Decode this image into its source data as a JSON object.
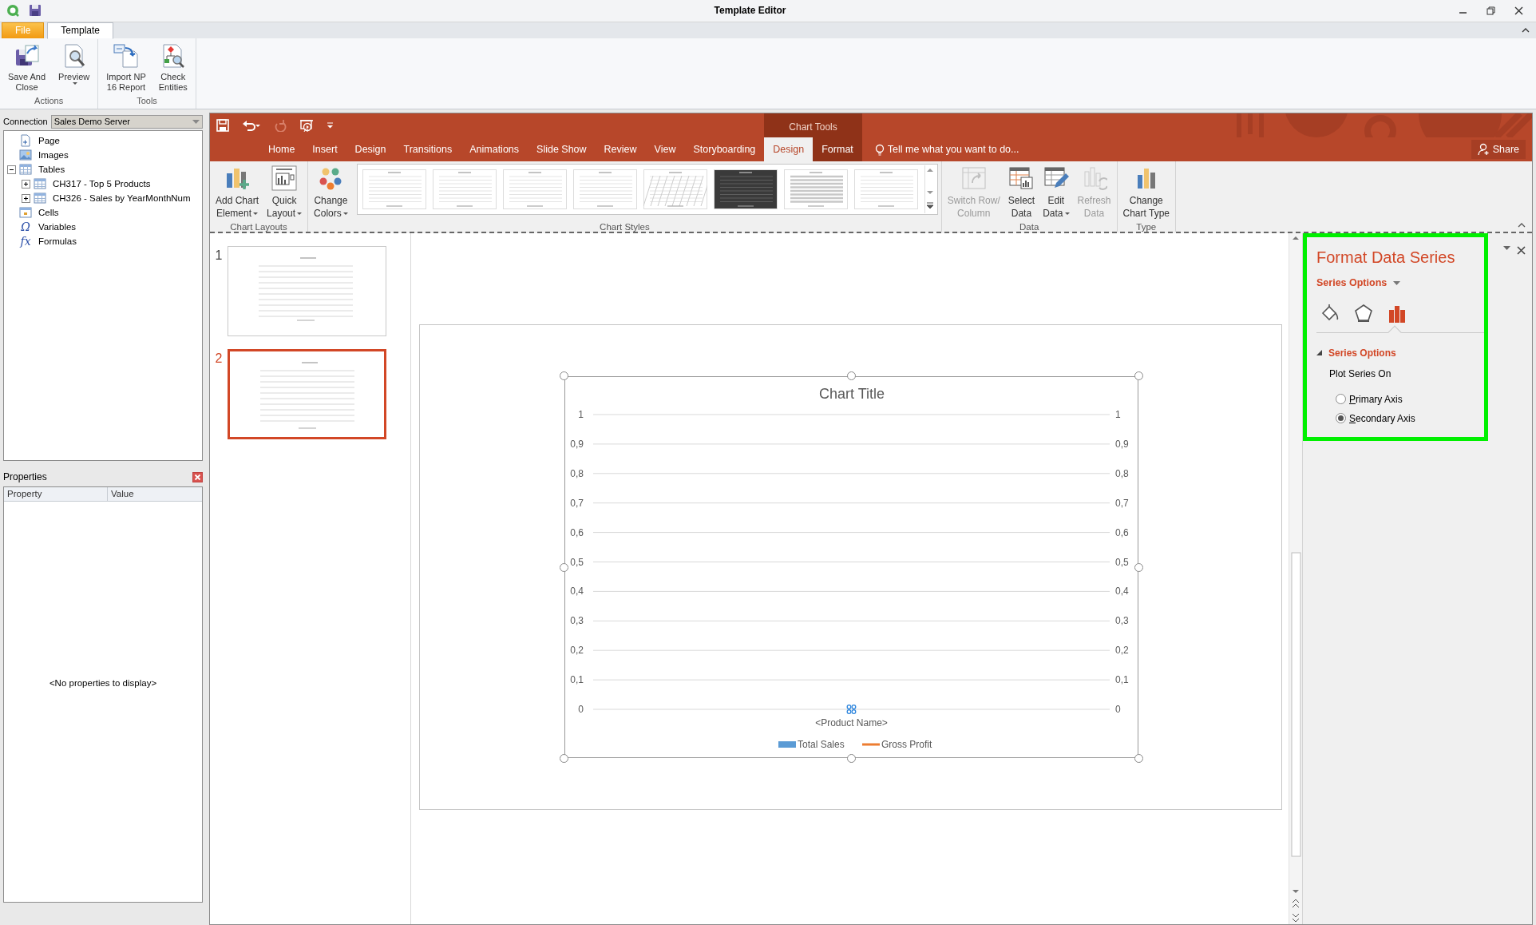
{
  "window": {
    "title": "Template Editor"
  },
  "app_tabs": [
    {
      "label": "File",
      "kind": "file",
      "selected": false
    },
    {
      "label": "Template",
      "kind": "tab",
      "selected": true
    }
  ],
  "app_ribbon": [
    {
      "label": "Actions",
      "buttons": [
        {
          "label": "Save And\nClose",
          "kind": "save",
          "dropdown": false
        },
        {
          "label": "Preview",
          "kind": "preview",
          "dropdown": true
        }
      ]
    },
    {
      "label": "Tools",
      "buttons": [
        {
          "label": "Import NP\n16 Report",
          "kind": "import",
          "dropdown": false
        },
        {
          "label": "Check\nEntities",
          "kind": "check",
          "dropdown": false
        }
      ]
    }
  ],
  "connection": {
    "label": "Connection",
    "value": "Sales Demo Server"
  },
  "tree": [
    {
      "label": "Page",
      "kind": "page"
    },
    {
      "label": "Images",
      "kind": "images"
    },
    {
      "label": "Tables",
      "kind": "table",
      "expanded": true,
      "children": [
        {
          "label": "CH317 - Top 5 Products",
          "kind": "table",
          "expanded": false
        },
        {
          "label": "CH326 - Sales by YearMonthNum",
          "kind": "table",
          "expanded": false
        }
      ]
    },
    {
      "label": "Cells",
      "kind": "cells"
    },
    {
      "label": "Variables",
      "kind": "glyph",
      "glyph": "Ω"
    },
    {
      "label": "Formulas",
      "kind": "glyph",
      "glyph": "fx"
    }
  ],
  "properties": {
    "title": "Properties",
    "columns": [
      "Property",
      "Value"
    ],
    "empty_text": "<No properties to display>"
  },
  "ppt": {
    "contextual_label": "Chart Tools",
    "tabs": [
      {
        "label": "Home",
        "contextual": false,
        "selected": false
      },
      {
        "label": "Insert",
        "contextual": false,
        "selected": false
      },
      {
        "label": "Design",
        "contextual": false,
        "selected": false
      },
      {
        "label": "Transitions",
        "contextual": false,
        "selected": false
      },
      {
        "label": "Animations",
        "contextual": false,
        "selected": false
      },
      {
        "label": "Slide Show",
        "contextual": false,
        "selected": false
      },
      {
        "label": "Review",
        "contextual": false,
        "selected": false
      },
      {
        "label": "View",
        "contextual": false,
        "selected": false
      },
      {
        "label": "Storyboarding",
        "contextual": false,
        "selected": false
      },
      {
        "label": "Design",
        "contextual": true,
        "selected": true
      },
      {
        "label": "Format",
        "contextual": true,
        "selected": false
      }
    ],
    "tell_me": "Tell me what you want to do...",
    "share": "Share",
    "ribbon": [
      {
        "label": "Chart Layouts",
        "buttons": [
          {
            "label": "Add Chart\nElement",
            "kind": "add-element",
            "dropdown": true,
            "disabled": false
          },
          {
            "label": "Quick\nLayout",
            "kind": "quick-layout",
            "dropdown": true,
            "disabled": false
          }
        ]
      },
      {
        "label": "Chart Styles",
        "buttons": [
          {
            "label": "Change\nColors",
            "kind": "colors",
            "dropdown": true,
            "disabled": false
          }
        ],
        "gallery": [
          {
            "kind": "light"
          },
          {
            "kind": "light"
          },
          {
            "kind": "light"
          },
          {
            "kind": "light"
          },
          {
            "kind": "hatched"
          },
          {
            "kind": "dark"
          },
          {
            "kind": "shaded"
          },
          {
            "kind": "light"
          }
        ]
      },
      {
        "label": "Data",
        "buttons": [
          {
            "label": "Switch Row/\nColumn",
            "kind": "switch",
            "dropdown": false,
            "disabled": true
          },
          {
            "label": "Select\nData",
            "kind": "select-data",
            "dropdown": false,
            "disabled": false
          },
          {
            "label": "Edit\nData",
            "kind": "edit-data",
            "dropdown": true,
            "disabled": false
          },
          {
            "label": "Refresh\nData",
            "kind": "refresh",
            "dropdown": false,
            "disabled": true
          }
        ]
      },
      {
        "label": "Type",
        "buttons": [
          {
            "label": "Change\nChart Type",
            "kind": "chart-type",
            "dropdown": false,
            "disabled": false
          }
        ]
      }
    ]
  },
  "slides": [
    {
      "number": "1",
      "selected": false
    },
    {
      "number": "2",
      "selected": true
    }
  ],
  "chart": {
    "chart_data": {
      "type": "bar",
      "title": "Chart Title",
      "categories": [
        "<Product Name>"
      ],
      "series": [
        {
          "name": "Total Sales",
          "color": "#5b9bd5",
          "values": [
            null
          ]
        },
        {
          "name": "Gross Profit",
          "color": "#ed7d31",
          "values": [
            null
          ]
        }
      ],
      "grid": true,
      "ylim": [
        0,
        1
      ],
      "yticks": [
        {
          "value": 1,
          "label": "1"
        },
        {
          "value": 0.9,
          "label": "0,9"
        },
        {
          "value": 0.8,
          "label": "0,8"
        },
        {
          "value": 0.7,
          "label": "0,7"
        },
        {
          "value": 0.6,
          "label": "0,6"
        },
        {
          "value": 0.5,
          "label": "0,5"
        },
        {
          "value": 0.4,
          "label": "0,4"
        },
        {
          "value": 0.3,
          "label": "0,3"
        },
        {
          "value": 0.2,
          "label": "0,2"
        },
        {
          "value": 0.1,
          "label": "0,1"
        },
        {
          "value": 0,
          "label": "0"
        }
      ]
    }
  },
  "format_pane": {
    "title": "Format Data Series",
    "options_menu": "Series Options",
    "icons": [
      {
        "kind": "fill",
        "selected": false
      },
      {
        "kind": "effects",
        "selected": false
      },
      {
        "kind": "bars",
        "selected": true
      }
    ],
    "section": {
      "title": "Series Options",
      "expanded": true,
      "label": "Plot Series On",
      "radios": [
        {
          "label": "Primary Axis",
          "selected": false
        },
        {
          "label": "Secondary Axis",
          "selected": true
        }
      ]
    }
  }
}
